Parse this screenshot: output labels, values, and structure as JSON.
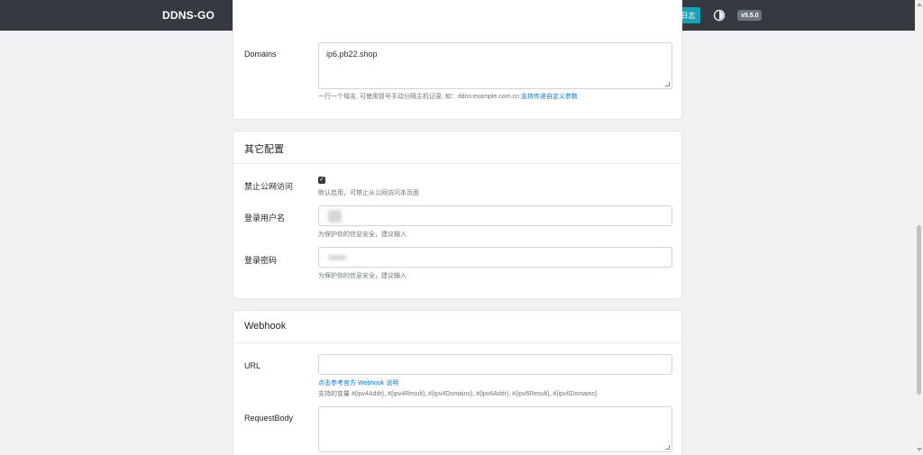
{
  "navbar": {
    "brand": "DDNS-GO",
    "log_button": "日志",
    "theme_icon": "half-circle-icon",
    "version": "v5.5.0"
  },
  "domains_card": {
    "label": "Domains",
    "value": "ip6.pb22.shop",
    "help_text": "一行一个域名, 可使用冒号手动分隔主机记录, 如：ddns:example.com.cn",
    "help_link": "支持传递自定义参数"
  },
  "other_card": {
    "title": "其它配置",
    "disable_public": {
      "label": "禁止公网访问",
      "checked": true,
      "help": "默认启用，可禁止从公网访问本页面"
    },
    "username": {
      "label": "登录用户名",
      "help": "为保护你的信息安全，建议输入"
    },
    "password": {
      "label": "登录密码",
      "help": "为保护你的信息安全，建议输入"
    }
  },
  "webhook_card": {
    "title": "Webhook",
    "url_label": "URL",
    "url_value": "",
    "url_link": "点击参考官方 Webhook 说明",
    "url_vars": "支持的变量 #{ipv4Addr}, #{ipv4Result}, #{ipv4Domains}, #{ipv6Addr}, #{ipv6Result}, #{ipv6Domains}",
    "body_label": "RequestBody",
    "body_value": ""
  },
  "colors": {
    "navbar": "#343a40",
    "log_button": "#17a2b8",
    "link": "#007bff",
    "background": "#f1f2f4"
  }
}
